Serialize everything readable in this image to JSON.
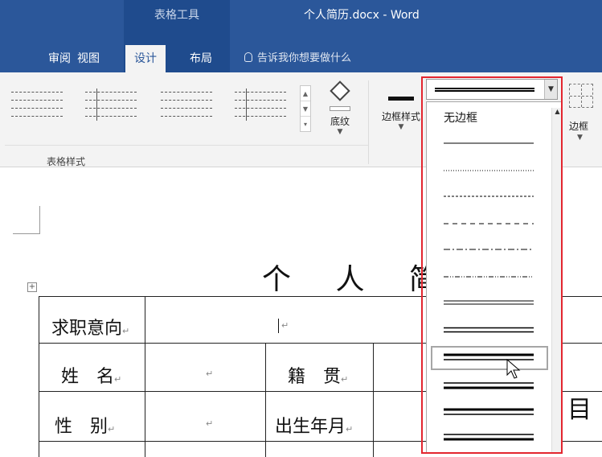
{
  "titlebar": {
    "context_group_title": "表格工具",
    "document_title": "个人简历.docx  -  Word"
  },
  "tabs": [
    {
      "label": "审阅",
      "active": false
    },
    {
      "label": "视图",
      "active": false
    },
    {
      "label": "设计",
      "active": true
    },
    {
      "label": "布局",
      "active": false
    }
  ],
  "tell_me": {
    "placeholder": "告诉我你想要做什么"
  },
  "ribbon": {
    "table_styles_group_label": "表格样式",
    "shading_label": "底纹",
    "border_styles_label": "边框样式",
    "borders_label_partial": "边框"
  },
  "border_style_dropdown": {
    "no_border_label": "无边框",
    "options": [
      "solid-thin",
      "dotted",
      "dashed-fine",
      "dashed",
      "dash-dot",
      "dash-dot-dot",
      "double",
      "double-medium",
      "thick-thin",
      "thin-thick",
      "thick-thin-medium",
      "thin-thick-thin"
    ],
    "highlighted_index": 8
  },
  "document": {
    "heading": "个 人 简 历",
    "rows": [
      {
        "label": "求职意向"
      },
      {
        "label": "姓　名",
        "second_label": "籍　贯"
      },
      {
        "label": "性　别",
        "second_label": "出生年月"
      }
    ],
    "paragraph_mark": "↵",
    "partial_right_char": "目"
  },
  "colors": {
    "accent_blue": "#2b579a",
    "highlight_red": "#e3262f"
  }
}
